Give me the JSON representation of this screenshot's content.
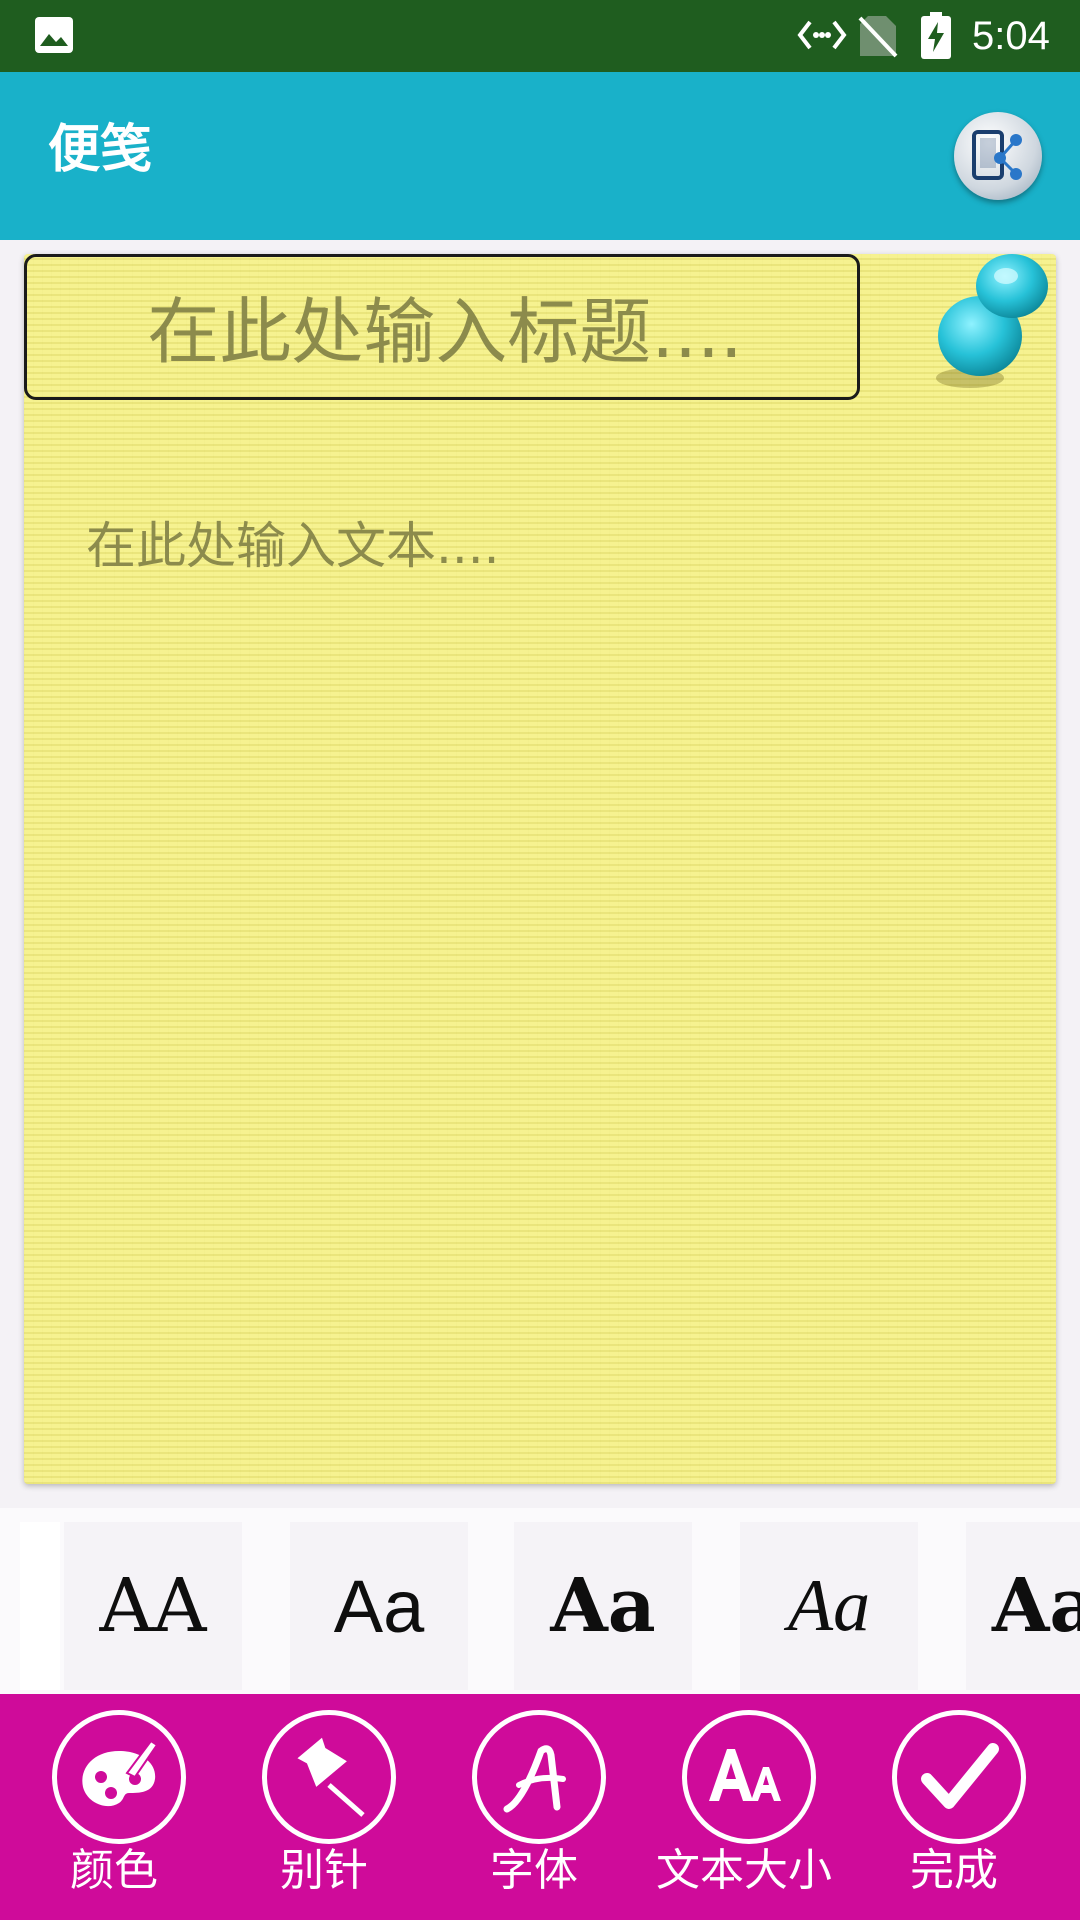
{
  "status_bar": {
    "time": "5:04",
    "icons": [
      "gallery-icon",
      "data-transfer-icon",
      "no-sim-icon",
      "battery-charging-icon"
    ]
  },
  "app_bar": {
    "title": "便笺",
    "share_icon": "share-note-icon"
  },
  "note": {
    "background_color": "#f4f08a",
    "title_placeholder": "在此处输入标题....",
    "body_placeholder": "在此处输入文本....",
    "pin_icon": "pushpin-icon"
  },
  "font_options": [
    {
      "sample": "AA"
    },
    {
      "sample": "Aa"
    },
    {
      "sample": "Aa"
    },
    {
      "sample": "Aa"
    },
    {
      "sample": "Aa"
    }
  ],
  "toolbar": {
    "background_color": "#cf0b9a",
    "items": [
      {
        "label": "颜色",
        "icon": "palette-icon"
      },
      {
        "label": "别针",
        "icon": "pin-icon"
      },
      {
        "label": "字体",
        "icon": "font-icon"
      },
      {
        "label": "文本大小",
        "icon": "text-size-icon"
      },
      {
        "label": "完成",
        "icon": "checkmark-icon"
      }
    ]
  },
  "colors": {
    "status_bar": "#1f5d1f",
    "app_bar": "#19b1c9"
  }
}
